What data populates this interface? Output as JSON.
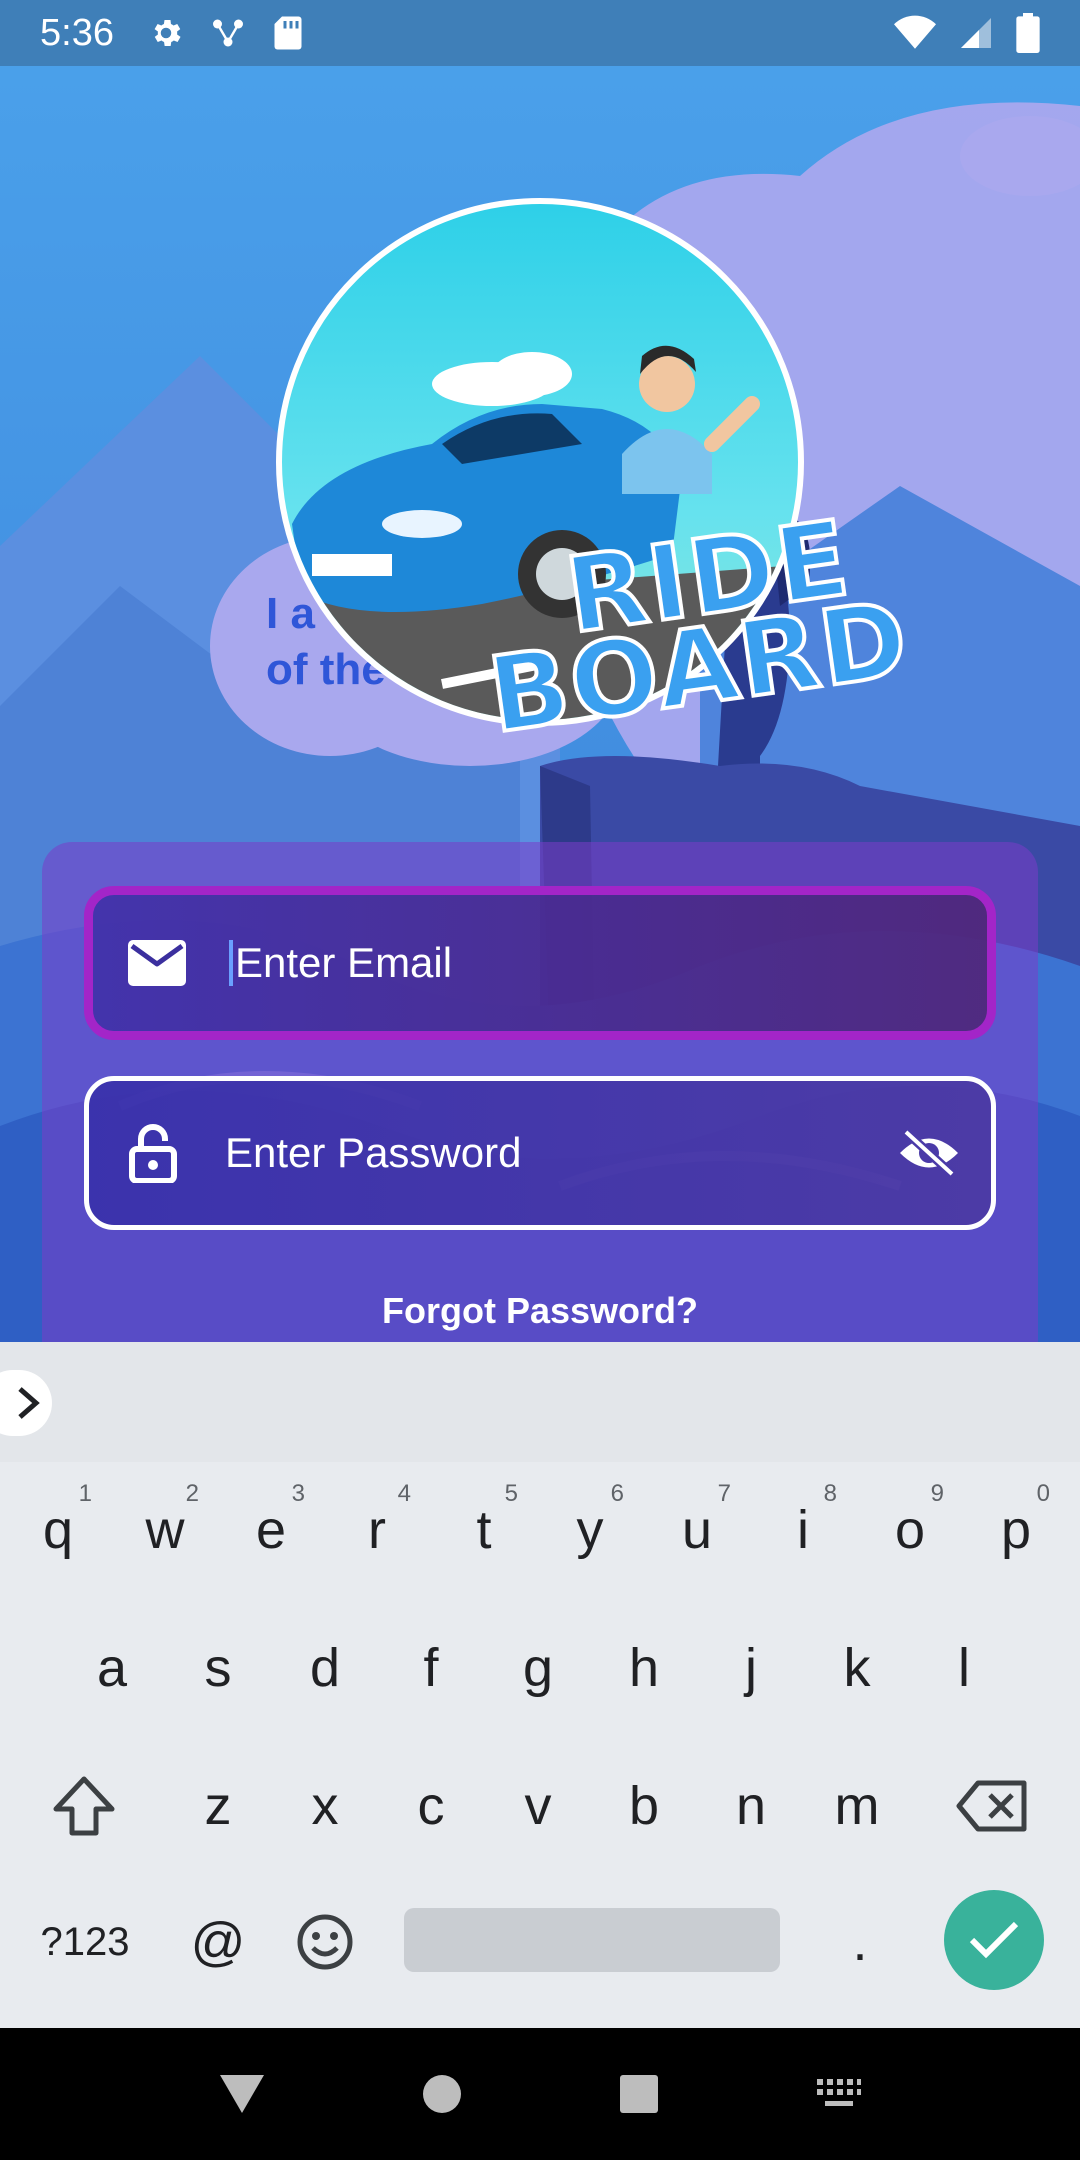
{
  "status_bar": {
    "time": "5:36",
    "left_icons": [
      "gear-icon",
      "nodes-icon",
      "sd-card-icon"
    ],
    "right_icons": [
      "wifi-icon",
      "signal-icon",
      "battery-icon"
    ]
  },
  "logo": {
    "line1": "RIDE",
    "line2": "BOARD"
  },
  "tagline": {
    "line1": "I a",
    "line2": "of the"
  },
  "login": {
    "email_placeholder": "Enter Email",
    "password_placeholder": "Enter Password",
    "forgot_password": "Forgot Password?",
    "colors": {
      "focused_border": "#a325c8",
      "field_border": "#ffffff",
      "card": "#7a3cc8"
    }
  },
  "keyboard": {
    "row1": [
      {
        "key": "q",
        "hint": "1"
      },
      {
        "key": "w",
        "hint": "2"
      },
      {
        "key": "e",
        "hint": "3"
      },
      {
        "key": "r",
        "hint": "4"
      },
      {
        "key": "t",
        "hint": "5"
      },
      {
        "key": "y",
        "hint": "6"
      },
      {
        "key": "u",
        "hint": "7"
      },
      {
        "key": "i",
        "hint": "8"
      },
      {
        "key": "o",
        "hint": "9"
      },
      {
        "key": "p",
        "hint": "0"
      }
    ],
    "row2": [
      "a",
      "s",
      "d",
      "f",
      "g",
      "h",
      "j",
      "k",
      "l"
    ],
    "row3": [
      "z",
      "x",
      "c",
      "v",
      "b",
      "n",
      "m"
    ],
    "symbols": "?123",
    "at": "@",
    "period": ".",
    "accent": "#39b29b"
  },
  "nav_bar": {
    "buttons": [
      "back-icon",
      "home-icon",
      "recents-icon",
      "keyboard-switch-icon"
    ]
  }
}
